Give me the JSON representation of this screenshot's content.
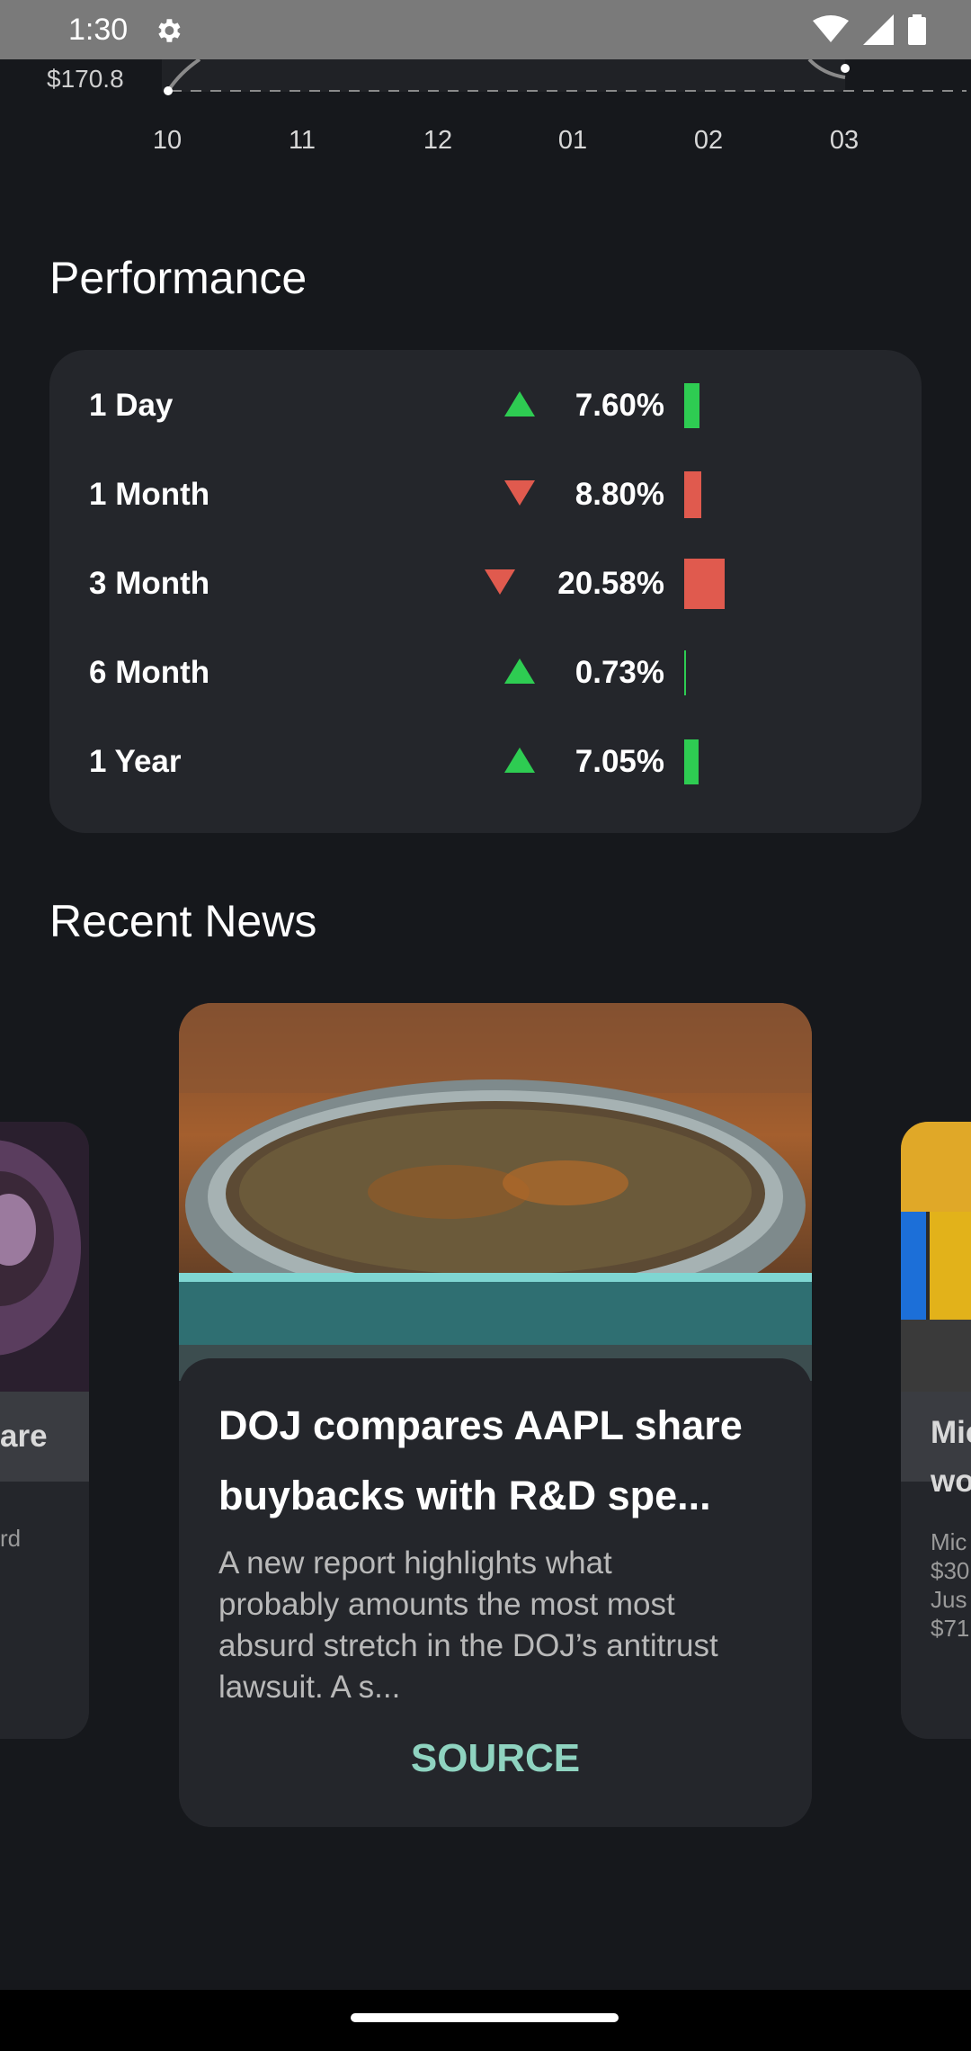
{
  "status_bar": {
    "time": "1:30"
  },
  "price_chart": {
    "price_label": "$170.8",
    "x_ticks": [
      "10",
      "11",
      "12",
      "01",
      "02",
      "03"
    ]
  },
  "performance": {
    "title": "Performance",
    "rows": [
      {
        "label": "1 Day",
        "value": "7.60%",
        "direction": "up",
        "percent": 7.6,
        "color": "#2ecc52"
      },
      {
        "label": "1 Month",
        "value": "8.80%",
        "direction": "down",
        "percent": 8.8,
        "color": "#e05a4e"
      },
      {
        "label": "3 Month",
        "value": "20.58%",
        "direction": "down",
        "percent": 20.58,
        "color": "#e05a4e"
      },
      {
        "label": "6 Month",
        "value": "0.73%",
        "direction": "up",
        "percent": 0.73,
        "color": "#2ecc52"
      },
      {
        "label": "1 Year",
        "value": "7.05%",
        "direction": "up",
        "percent": 7.05,
        "color": "#2ecc52"
      }
    ]
  },
  "news": {
    "title": "Recent News",
    "main": {
      "headline": "DOJ compares AAPL share buybacks with R&D spe...",
      "description": "A new report highlights what probably amounts the most most absurd stretch in the DOJ’s antitrust lawsuit. A s...",
      "source_label": "SOURCE"
    },
    "left_partial": {
      "title_fragment": "are",
      "text_fragment": "rd"
    },
    "right_partial": {
      "title_lines": [
        "Mic",
        "wo"
      ],
      "text_lines": [
        "Mic",
        "$30",
        "Jus",
        "$71"
      ]
    }
  },
  "colors": {
    "up": "#2ecc52",
    "down": "#e05a4e",
    "source": "#8fd3c0",
    "card": "#24262b"
  }
}
